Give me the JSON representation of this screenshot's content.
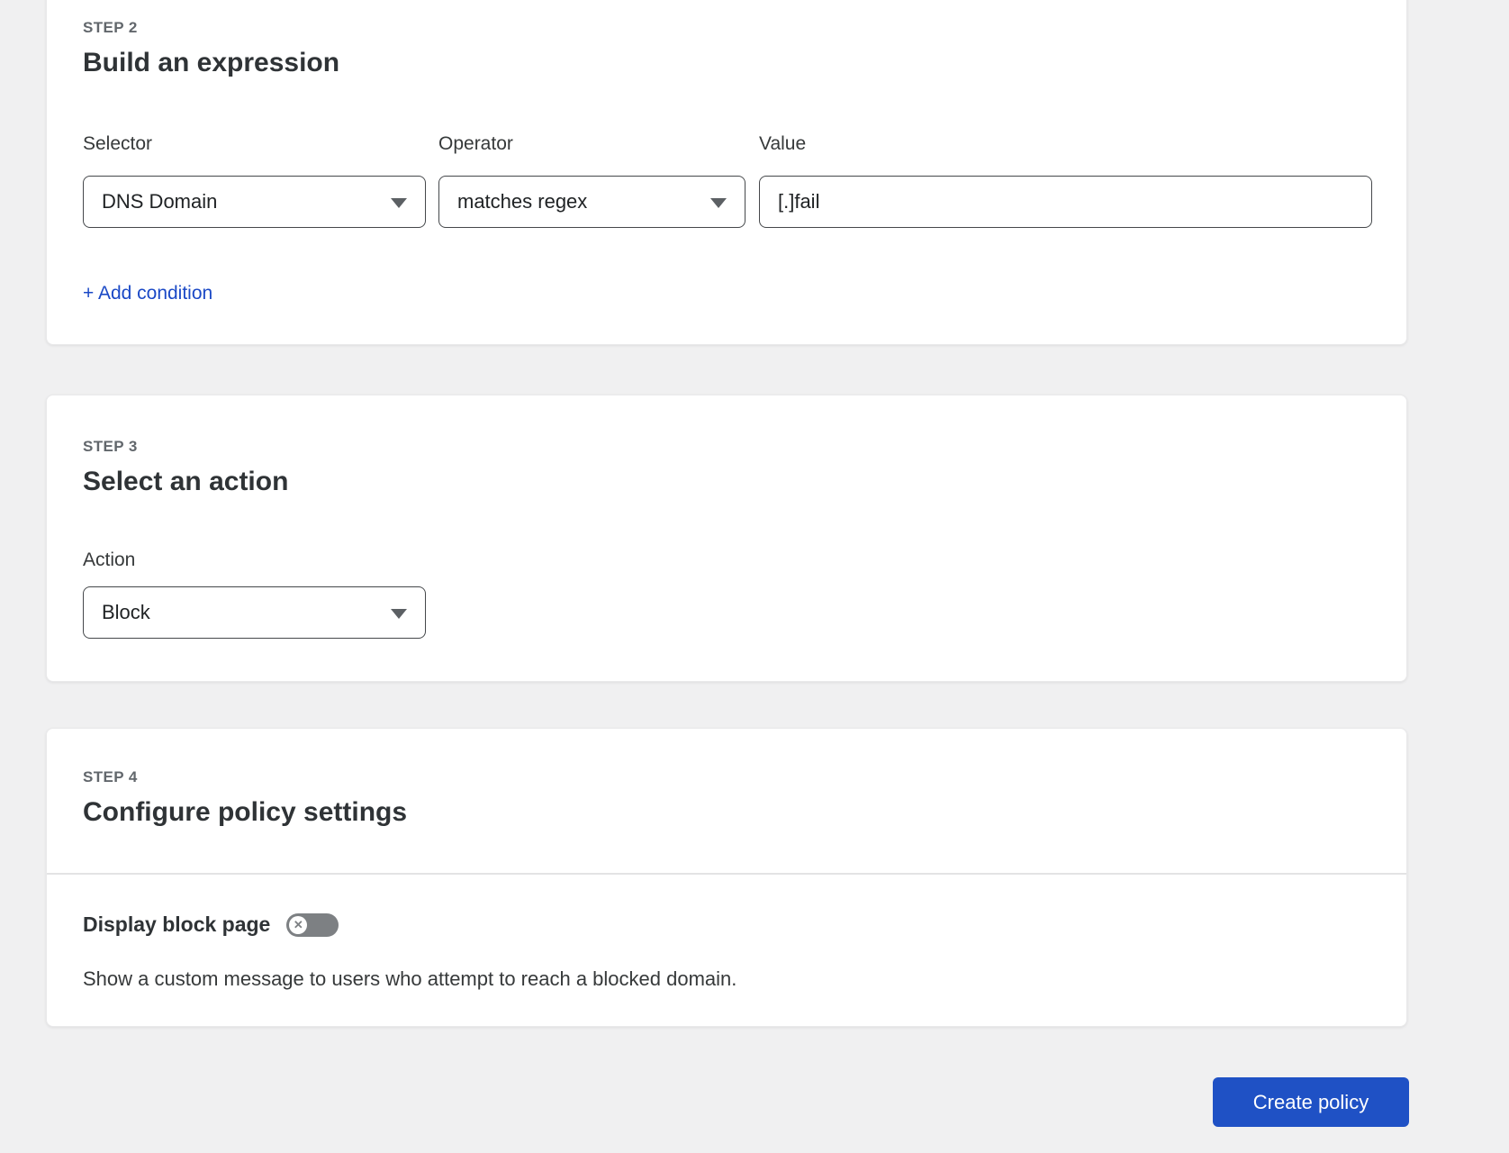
{
  "step2": {
    "step_label": "STEP 2",
    "title": "Build an expression",
    "selector": {
      "label": "Selector",
      "value": "DNS Domain"
    },
    "operator": {
      "label": "Operator",
      "value": "matches regex"
    },
    "value_field": {
      "label": "Value",
      "value": "[.]fail"
    },
    "add_condition_label": "+ Add condition"
  },
  "step3": {
    "step_label": "STEP 3",
    "title": "Select an action",
    "action": {
      "label": "Action",
      "value": "Block"
    }
  },
  "step4": {
    "step_label": "STEP 4",
    "title": "Configure policy settings",
    "display_block_page": {
      "label": "Display block page",
      "state": "off",
      "toggle_icon": "✕",
      "description": "Show a custom message to users who attempt to reach a blocked domain."
    }
  },
  "footer": {
    "create_policy_label": "Create policy"
  },
  "colors": {
    "accent_blue": "#1f51c5",
    "link_blue": "#1b49c6",
    "toggle_off_gray": "#7d8083",
    "page_background": "#f0f0f1"
  }
}
